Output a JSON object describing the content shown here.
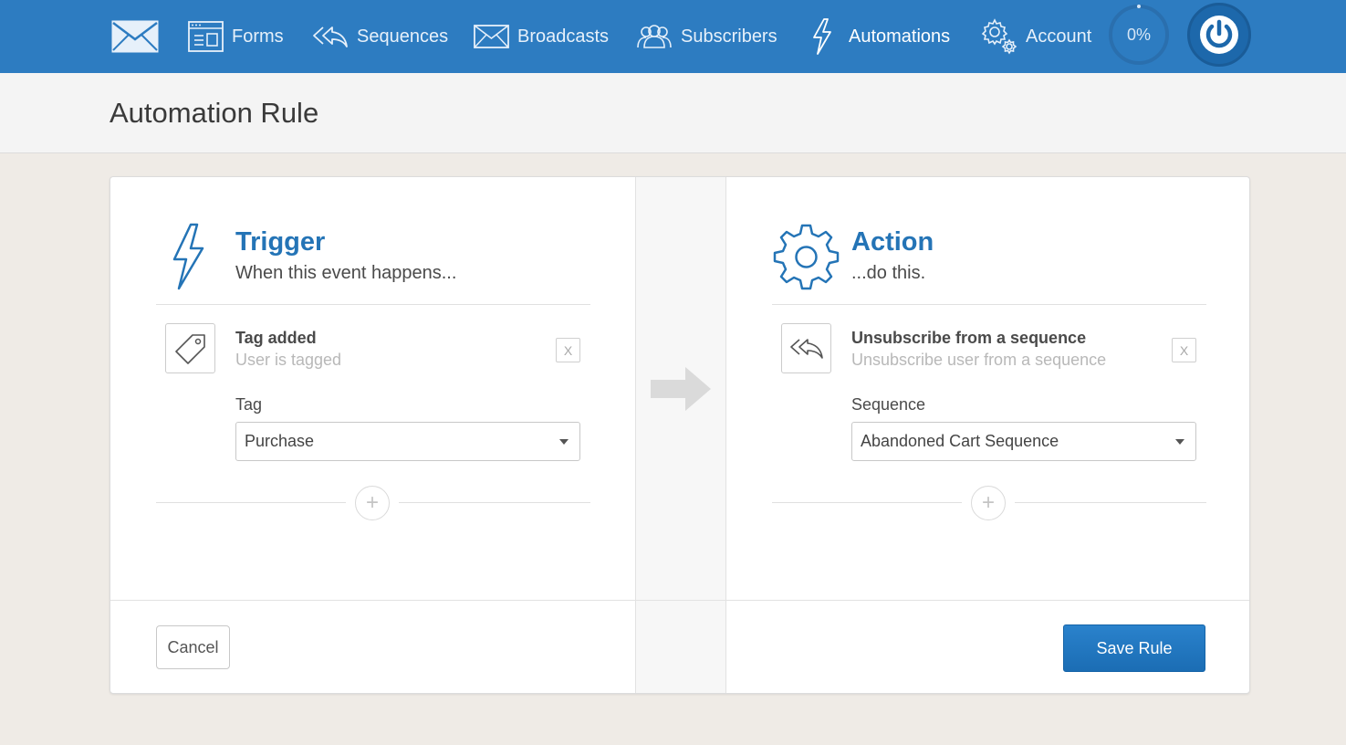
{
  "nav": {
    "items": [
      {
        "label": "Forms",
        "icon": "forms-icon"
      },
      {
        "label": "Sequences",
        "icon": "sequences-icon"
      },
      {
        "label": "Broadcasts",
        "icon": "broadcasts-icon"
      },
      {
        "label": "Subscribers",
        "icon": "subscribers-icon"
      },
      {
        "label": "Automations",
        "icon": "automations-icon",
        "active": true
      },
      {
        "label": "Account",
        "icon": "account-icon"
      }
    ],
    "progress": "0%",
    "logo_icon": "mail-icon",
    "power_icon": "power-icon"
  },
  "page": {
    "title": "Automation Rule"
  },
  "trigger": {
    "title": "Trigger",
    "subtitle": "When this event happens...",
    "item_title": "Tag added",
    "item_subtitle": "User is tagged",
    "remove_label": "X",
    "field_label": "Tag",
    "selected": "Purchase",
    "add_label": "+"
  },
  "action": {
    "title": "Action",
    "subtitle": "...do this.",
    "item_title": "Unsubscribe from a sequence",
    "item_subtitle": "Unsubscribe user from a sequence",
    "remove_label": "X",
    "field_label": "Sequence",
    "selected": "Abandoned Cart Sequence",
    "add_label": "+"
  },
  "footer": {
    "cancel_label": "Cancel",
    "save_label": "Save Rule"
  },
  "colors": {
    "nav_bg": "#2d7cc1",
    "accent": "#2474b6",
    "page_bg": "#efebe6"
  }
}
